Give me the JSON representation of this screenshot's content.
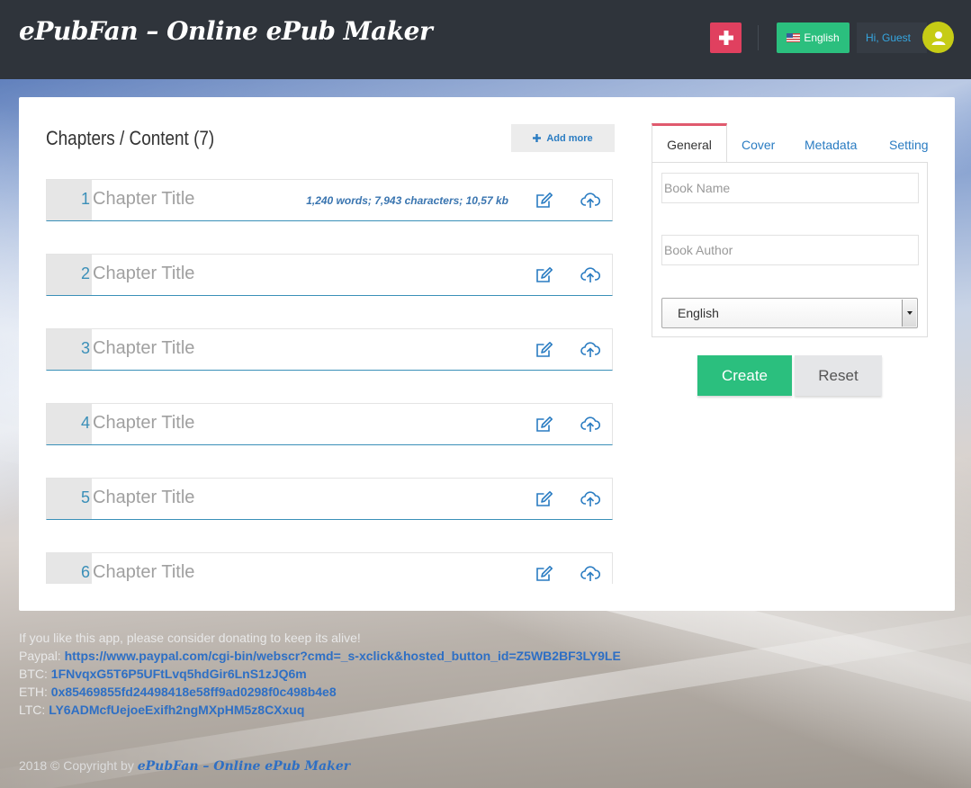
{
  "header": {
    "brand": "ePubFan – Online ePub Maker",
    "language_label": "English",
    "greeting": "Hi, Guest"
  },
  "chapters": {
    "heading": "Chapters / Content (7)",
    "add_more_label": "Add more",
    "items": [
      {
        "number": "1",
        "placeholder": "Chapter Title",
        "stats": "1,240 words; 7,943 characters; 10,57 kb"
      },
      {
        "number": "2",
        "placeholder": "Chapter Title",
        "stats": ""
      },
      {
        "number": "3",
        "placeholder": "Chapter Title",
        "stats": ""
      },
      {
        "number": "4",
        "placeholder": "Chapter Title",
        "stats": ""
      },
      {
        "number": "5",
        "placeholder": "Chapter Title",
        "stats": ""
      },
      {
        "number": "6",
        "placeholder": "Chapter Title",
        "stats": ""
      }
    ]
  },
  "settings_panel": {
    "tabs": [
      "General",
      "Cover",
      "Metadata",
      "Setting"
    ],
    "active_tab": "General",
    "book_name_placeholder": "Book Name",
    "book_author_placeholder": "Book Author",
    "language_selected": "English"
  },
  "actions": {
    "create_label": "Create",
    "reset_label": "Reset"
  },
  "footer": {
    "donate_intro": "If you like this app, please consider donating to keep its alive!",
    "paypal_label": "Paypal:",
    "paypal_value": "https://www.paypal.com/cgi-bin/webscr?cmd=_s-xclick&hosted_button_id=Z5WB2BF3LY9LE",
    "btc_label": "BTC:",
    "btc_value": "1FNvqxG5T6P5UFtLvq5hdGir6LnS1zJQ6m",
    "eth_label": "ETH:",
    "eth_value": "0x85469855fd24498418e58ff9ad0298f0c498b4e8",
    "ltc_label": "LTC:",
    "ltc_value": "LY6ADMcfUejoeExifh2ngMXpHM5z8CXxuq",
    "copyright_prefix": "2018 © Copyright by",
    "copyright_brand": "ePubFan – Online ePub Maker"
  },
  "colors": {
    "header_bg": "#2f343b",
    "accent_green": "#2bbf7e",
    "accent_red": "#e0405f",
    "avatar_yellow": "#c6cc15",
    "link_blue": "#2a7cc2"
  },
  "icons": {
    "plus": "plus-icon",
    "flag": "us-flag-icon",
    "avatar": "user-icon",
    "edit": "edit-icon",
    "upload": "cloud-upload-icon"
  }
}
